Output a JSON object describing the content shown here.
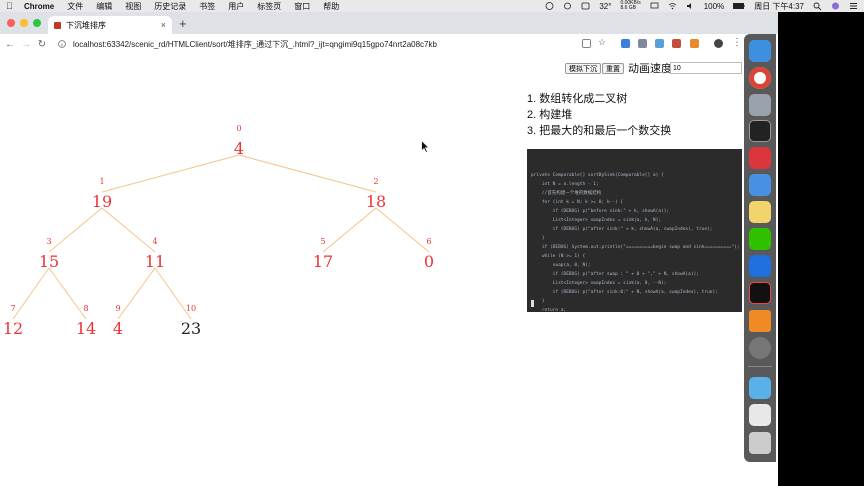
{
  "menubar": {
    "app": "Chrome",
    "items": [
      "文件",
      "编辑",
      "视图",
      "历史记录",
      "书签",
      "用户",
      "标签页",
      "窗口",
      "帮助"
    ],
    "temp": "32°",
    "net_up": "0.00KB/s",
    "net_down": "8.6 GB",
    "battery": "100%",
    "clock": "周日 下午4:37"
  },
  "browser": {
    "tab_title": "下沉堆排序",
    "url": "localhost:63342/scenic_rd/HTMLClient/sort/堆排序_通过下沉_.html?_ijt=qngimi9q15gpo74nrt2a08c7kb"
  },
  "controls": {
    "simulate_label": "模拟下沉",
    "reset_label": "重置",
    "speed_label": "动画速度",
    "speed_value": "10"
  },
  "steps": [
    "1. 数组转化成二叉树",
    "2. 构建堆",
    "3. 把最大的和最后一个数交换"
  ],
  "tree": {
    "nodes": [
      {
        "index": "0",
        "value": "4",
        "color": "#e33"
      },
      {
        "index": "1",
        "value": "19",
        "color": "#e33"
      },
      {
        "index": "2",
        "value": "18",
        "color": "#e33"
      },
      {
        "index": "3",
        "value": "15",
        "color": "#e33"
      },
      {
        "index": "4",
        "value": "11",
        "color": "#e33"
      },
      {
        "index": "5",
        "value": "17",
        "color": "#e33"
      },
      {
        "index": "6",
        "value": "0",
        "color": "#e33"
      },
      {
        "index": "7",
        "value": "12",
        "color": "#e33"
      },
      {
        "index": "8",
        "value": "14",
        "color": "#e33"
      },
      {
        "index": "9",
        "value": "4",
        "color": "#e33"
      },
      {
        "index": "10",
        "value": "23",
        "color": "#222"
      }
    ],
    "edge_color": "#f5c48a"
  },
  "code_lines": [
    "private Comparable[] sortBySink(Comparable[] a) {",
    "    int N = a.length - 1;",
    "    //首先构建一个堆的数据结构",
    "    for (int k = N; k >= 0; k--) {",
    "        if (DEBUG) p(\"before sink:\" + k, showA(a));",
    "        List<Integer> swapIndex = sink(a, k, N);",
    "        if (DEBUG) p(\"after sink:\" + k, showA(a, swapIndex), true);",
    "    }",
    "    if (DEBUG) System.out.println(\"==========begin swap and sink==========\");",
    "    while (N >= 1) {",
    "        swap(a, 0, N);",
    "        if (DEBUG) p(\"after swap : \" + 0 + \",\" + N, showA(a));",
    "        List<Integer> swapIndex = sink(a, 0, --N);",
    "        if (DEBUG) p(\"after sink:0:\" + N, showA(a, swapIndex), true);",
    "    }",
    "    return a;"
  ],
  "colors": {
    "node_red": "#e33",
    "node_black": "#222",
    "code_bg": "#2b2b2b"
  }
}
